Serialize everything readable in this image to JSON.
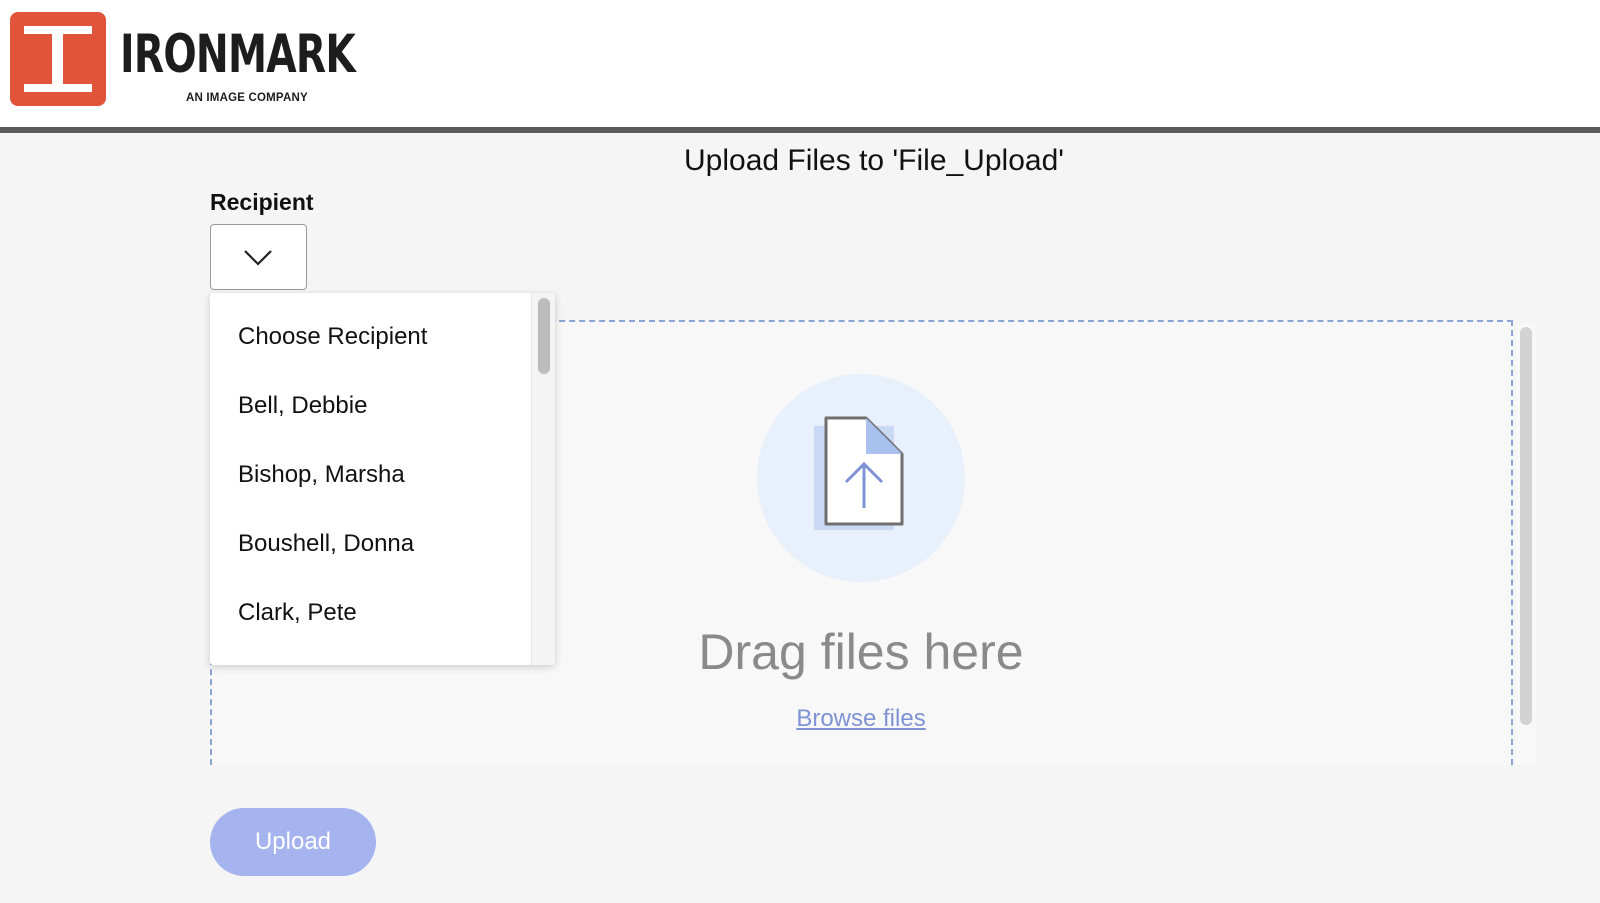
{
  "header": {
    "logo_word": "IRONMARK",
    "logo_tagline": "AN IMAGE COMPANY",
    "brand_color": "#e2543a"
  },
  "page": {
    "title": "Upload Files to 'File_Upload'"
  },
  "recipient": {
    "label": "Recipient",
    "dropdown_open": true,
    "options": [
      "Choose Recipient",
      "Bell, Debbie",
      "Bishop, Marsha",
      "Boushell, Donna",
      "Clark, Pete"
    ]
  },
  "dropzone": {
    "drag_text": "Drag files here",
    "browse_label": "Browse files",
    "icon": "file-upload-icon"
  },
  "actions": {
    "upload_label": "Upload"
  },
  "colors": {
    "accent": "#7f93d4",
    "button": "#a5b3ee",
    "dashed_border": "#8aa4d6"
  }
}
